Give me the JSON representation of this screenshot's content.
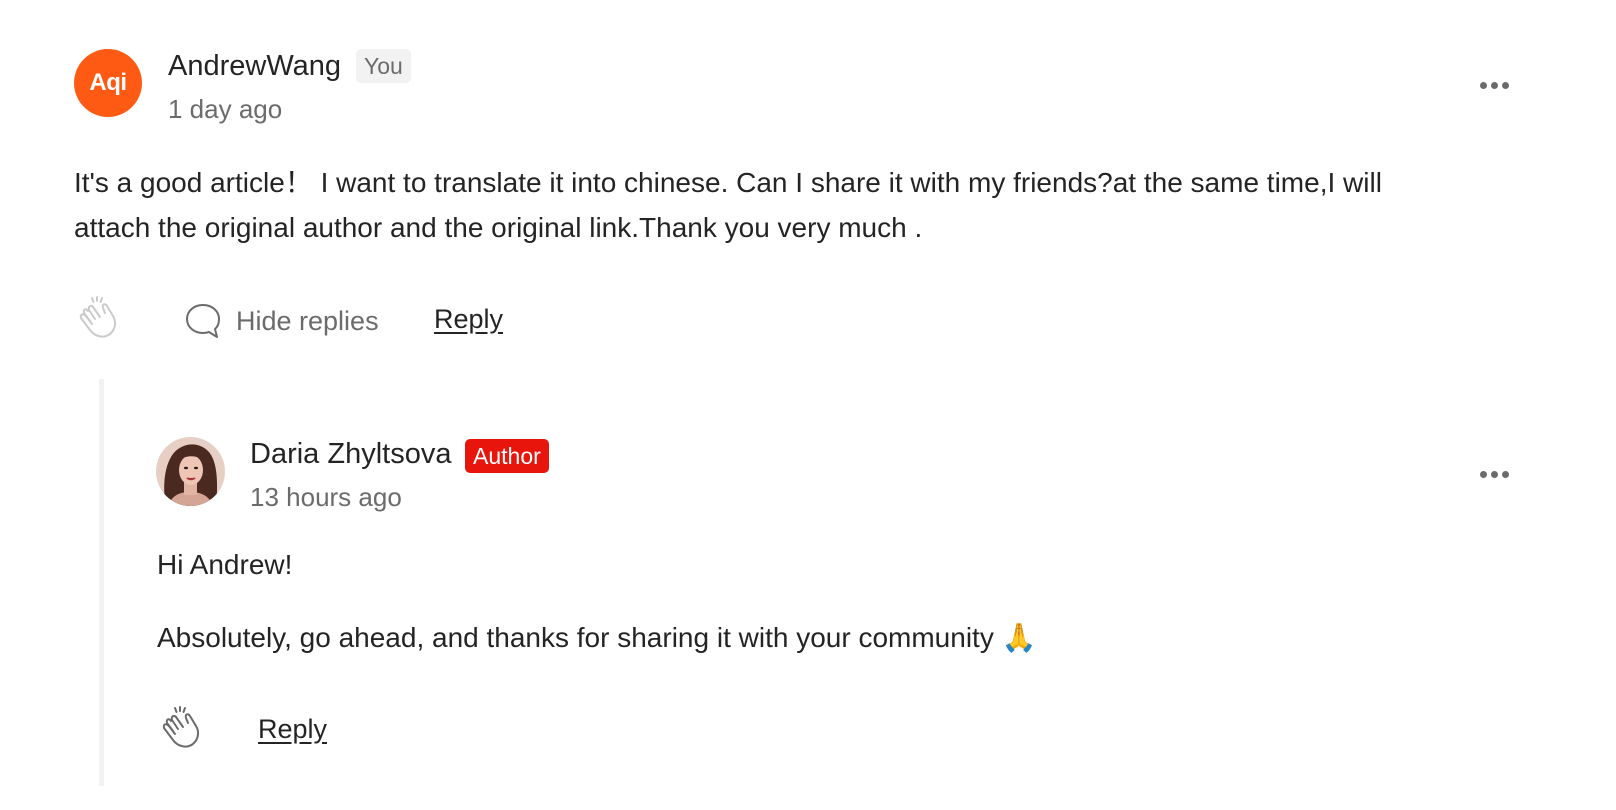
{
  "comment": {
    "avatar_text": "Aqi",
    "author": "AndrewWang",
    "badge": "You",
    "time": "1 day ago",
    "body_line1": "It's a good article！  I want to translate it into chinese. Can I share it with my friends?at the same time,I will",
    "body_line2": "attach the original author and the original link.Thank you very much .",
    "hide_replies_label": "Hide replies",
    "reply_label": "Reply",
    "more_icon": "more-horizontal-icon",
    "clap_icon": "clap-icon",
    "reply_icon": "speech-bubble-icon"
  },
  "reply": {
    "author": "Daria Zhyltsova",
    "badge": "Author",
    "time": "13 hours ago",
    "body_line1": "Hi Andrew!",
    "body_line2": "Absolutely, go ahead, and thanks for sharing it with your community 🙏",
    "reply_label": "Reply",
    "more_icon": "more-horizontal-icon",
    "clap_icon": "clap-icon"
  },
  "colors": {
    "aqi_avatar": "#ff5a14",
    "author_badge": "#e8150c",
    "you_badge": "#f2f2f2",
    "muted_text": "#6b6b6b",
    "body_text": "#242424",
    "thread_line": "#f2f2f2"
  }
}
